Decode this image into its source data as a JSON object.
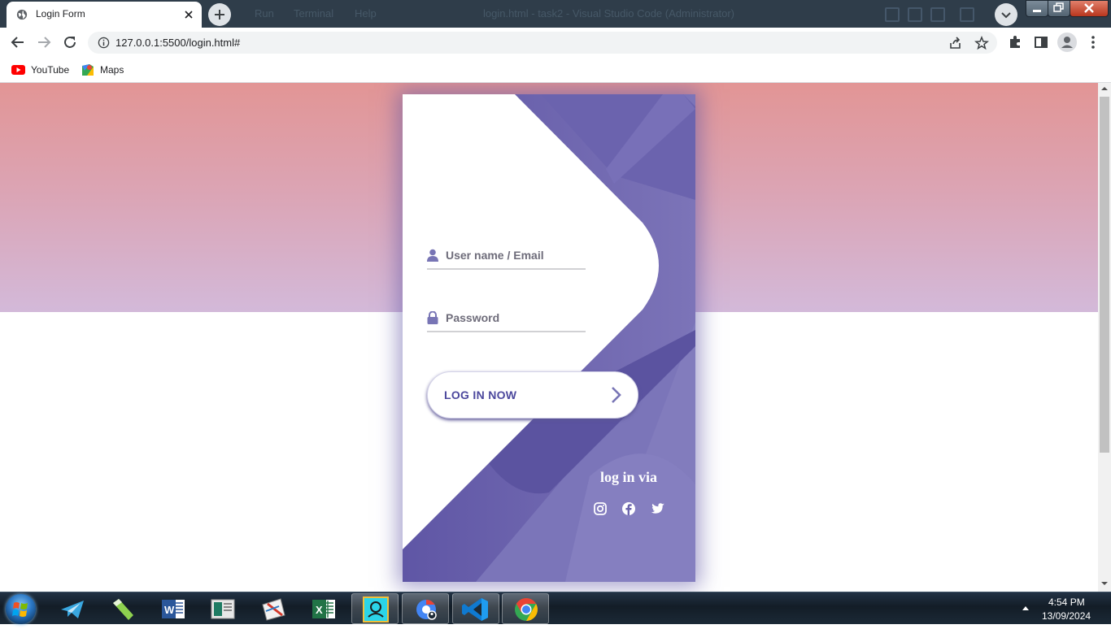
{
  "browser": {
    "tab": {
      "title": "Login Form"
    },
    "background_window": {
      "menu_items": [
        "Run",
        "Terminal",
        "Help"
      ],
      "title": "login.html - task2 - Visual Studio Code (Administrator)"
    },
    "address": {
      "url": "127.0.0.1:5500/login.html#"
    },
    "bookmarks": [
      {
        "label": "YouTube",
        "icon": "youtube-icon"
      },
      {
        "label": "Maps",
        "icon": "maps-icon"
      }
    ]
  },
  "page": {
    "colors": {
      "gradient_top": "#e29595",
      "gradient_bottom": "#d3b9d9",
      "card_purple": "#5f56a5",
      "card_light_purple": "#7c74b8",
      "button_text": "#4c489d"
    },
    "form": {
      "username_placeholder": "User name / Email",
      "password_placeholder": "Password",
      "login_button": "LOG IN NOW"
    },
    "social": {
      "title": "log in via",
      "icons": [
        "instagram-icon",
        "facebook-icon",
        "twitter-icon"
      ]
    }
  },
  "taskbar": {
    "apps": [
      "telegram",
      "notepad++",
      "word",
      "publisher",
      "paint",
      "excel",
      "sparkle",
      "chrome-profile",
      "vscode",
      "chrome"
    ],
    "clock": {
      "time": "4:54 PM",
      "date": "13/09/2024"
    }
  }
}
